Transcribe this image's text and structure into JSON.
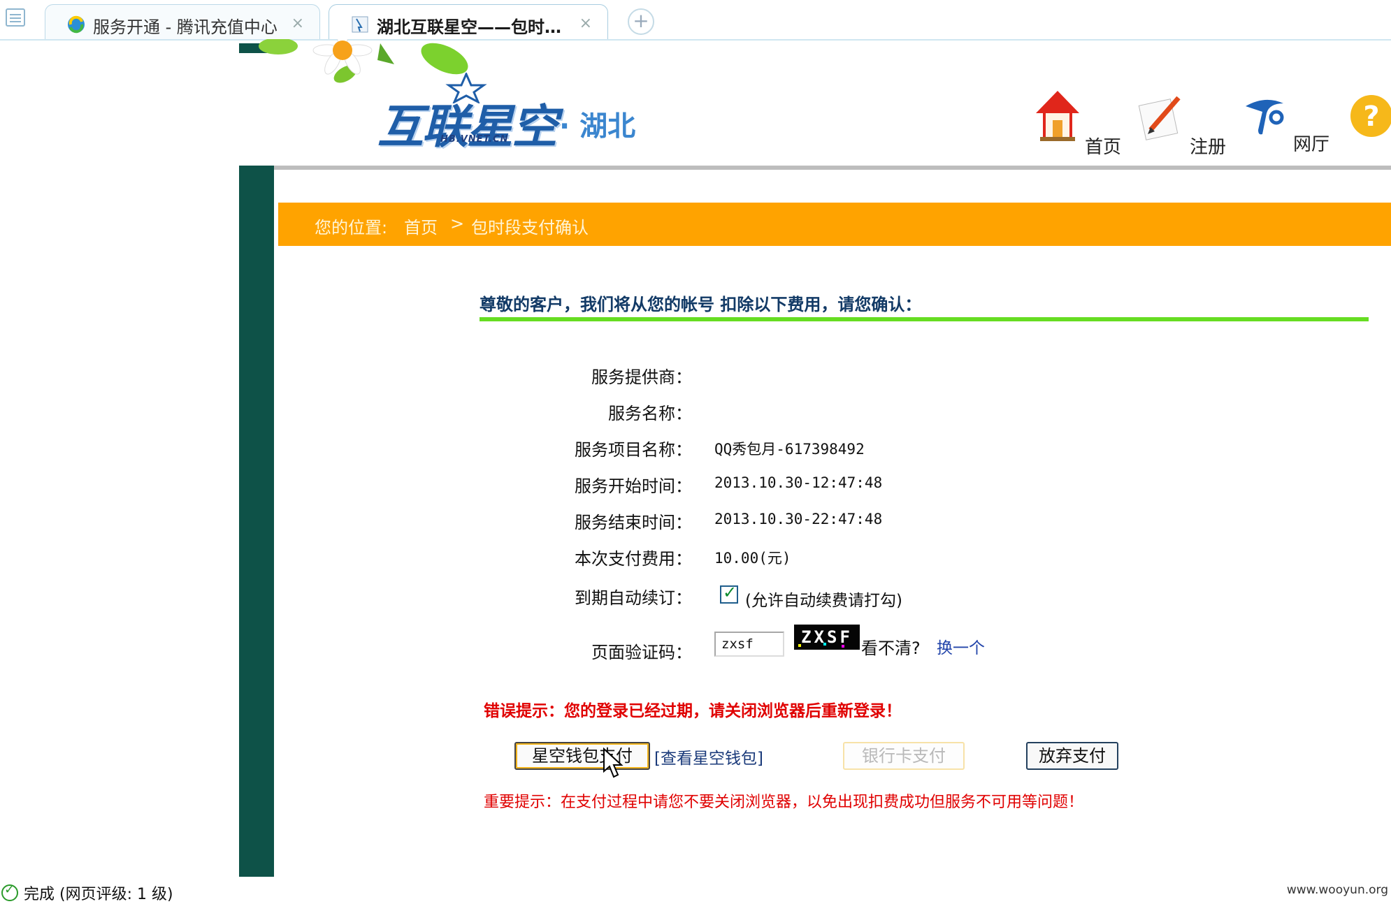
{
  "browser": {
    "tabs": [
      {
        "title": "服务开通 - 腾讯充值中心",
        "close": "×"
      },
      {
        "title": "湖北互联星空——包时…",
        "close": "×"
      }
    ],
    "new_tab": "+"
  },
  "site": {
    "logo_main": "互联星空",
    "logo_domain": "HB.VNET.CN",
    "logo_region": "· 湖北",
    "nav": [
      {
        "label": "首页",
        "icon": "home-icon"
      },
      {
        "label": "注册",
        "icon": "register-icon"
      },
      {
        "label": "网厅",
        "icon": "china-telecom-icon"
      },
      {
        "label": "",
        "icon": "help-icon"
      }
    ]
  },
  "breadcrumb": {
    "prefix": "您的位置:",
    "home": "首页",
    "separator": ">",
    "current": "包时段支付确认"
  },
  "confirm": {
    "intro": "尊敬的客户，我们将从您的帐号 扣除以下费用，请您确认：",
    "rows": [
      {
        "label": "服务提供商：",
        "value": ""
      },
      {
        "label": "服务名称：",
        "value": ""
      },
      {
        "label": "服务项目名称：",
        "value": "QQ秀包月-617398492"
      },
      {
        "label": "服务开始时间：",
        "value": "2013.10.30-12:47:48"
      },
      {
        "label": "服务结束时间：",
        "value": "2013.10.30-22:47:48"
      },
      {
        "label": "本次支付费用：",
        "value": "10.00(元)"
      }
    ],
    "autorenew_label": "到期自动续订：",
    "autorenew_checked": true,
    "autorenew_text": "(允许自动续费请打勾)",
    "captcha_label": "页面验证码：",
    "captcha_value": "zxsf",
    "captcha_image_text": "ZXSF",
    "captcha_unclear": "看不清?",
    "captcha_change": "换一个",
    "error": "错误提示：您的登录已经过期，请关闭浏览器后重新登录！",
    "buttons": {
      "wallet_pay": "星空钱包支付",
      "view_wallet": "[查看星空钱包]",
      "bank_pay": "银行卡支付",
      "abandon": "放弃支付"
    },
    "notice": "重要提示：在支付过程中请您不要关闭浏览器，以免出现扣费成功但服务不可用等问题！"
  },
  "status_bar": {
    "text": "完成 (网页评级: 1 级)",
    "watermark": "www.wooyun.org"
  },
  "colors": {
    "sidebar": "#0e5248",
    "breadcrumb_bg": "#ffa300",
    "rule": "#66dd22",
    "error": "#e00000",
    "logo": "#1f5ea8"
  }
}
